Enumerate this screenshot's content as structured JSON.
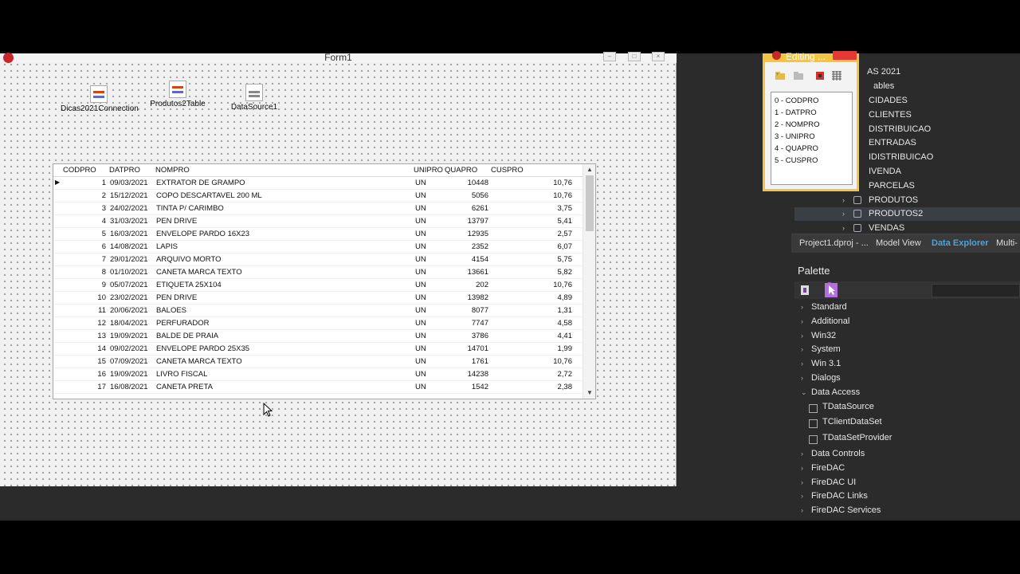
{
  "form": {
    "title": "Form1",
    "components": [
      {
        "name": "Dicas2021Connection"
      },
      {
        "name": "Produtos2Table"
      },
      {
        "name": "DataSource1"
      }
    ]
  },
  "grid": {
    "columns": [
      "CODPRO",
      "DATPRO",
      "NOMPRO",
      "UNIPRO",
      "QUAPRO",
      "CUSPRO"
    ],
    "rows": [
      [
        "1",
        "09/03/2021",
        "EXTRATOR DE GRAMPO",
        "UN",
        "10448",
        "10,76"
      ],
      [
        "2",
        "15/12/2021",
        "COPO DESCARTAVEL 200 ML",
        "UN",
        "5056",
        "10,76"
      ],
      [
        "3",
        "24/02/2021",
        "TINTA P/ CARIMBO",
        "UN",
        "6261",
        "3,75"
      ],
      [
        "4",
        "31/03/2021",
        "PEN DRIVE",
        "UN",
        "13797",
        "5,41"
      ],
      [
        "5",
        "16/03/2021",
        "ENVELOPE PARDO 16X23",
        "UN",
        "12935",
        "2,57"
      ],
      [
        "6",
        "14/08/2021",
        "LAPIS",
        "UN",
        "2352",
        "6,07"
      ],
      [
        "7",
        "29/01/2021",
        "ARQUIVO MORTO",
        "UN",
        "4154",
        "5,75"
      ],
      [
        "8",
        "01/10/2021",
        "CANETA MARCA TEXTO",
        "UN",
        "13661",
        "5,82"
      ],
      [
        "9",
        "05/07/2021",
        "ETIQUETA 25X104",
        "UN",
        "202",
        "10,76"
      ],
      [
        "10",
        "23/02/2021",
        "PEN DRIVE",
        "UN",
        "13982",
        "4,89"
      ],
      [
        "11",
        "20/06/2021",
        "BALOES",
        "UN",
        "8077",
        "1,31"
      ],
      [
        "12",
        "18/04/2021",
        "PERFURADOR",
        "UN",
        "7747",
        "4,58"
      ],
      [
        "13",
        "19/09/2021",
        "BALDE DE PRAIA",
        "UN",
        "3786",
        "4,41"
      ],
      [
        "14",
        "09/02/2021",
        "ENVELOPE PARDO 25X35",
        "UN",
        "14701",
        "1,99"
      ],
      [
        "15",
        "07/09/2021",
        "CANETA MARCA TEXTO",
        "UN",
        "1761",
        "10,76"
      ],
      [
        "16",
        "19/09/2021",
        "LIVRO FISCAL",
        "UN",
        "14238",
        "2,72"
      ],
      [
        "17",
        "16/08/2021",
        "CANETA PRETA",
        "UN",
        "1542",
        "2,38"
      ]
    ],
    "current_row_indicator": "▶"
  },
  "fields_editor": {
    "title": "Editing ...",
    "fields": [
      "0 - CODPRO",
      "1 - DATPRO",
      "2 - NOMPRO",
      "3 - UNIPRO",
      "4 - QUAPRO",
      "5 - CUSPRO"
    ]
  },
  "data_explorer": {
    "root_label": "AS 2021",
    "tables_label": "ables",
    "tables": [
      "CIDADES",
      "CLIENTES",
      "DISTRIBUICAO",
      "ENTRADAS",
      "IDISTRIBUICAO",
      "IVENDA",
      "PARCELAS",
      "PRODUTOS",
      "PRODUTOS2",
      "VENDAS"
    ],
    "selected": "PRODUTOS2"
  },
  "bottom_tabs": [
    "Project1.dproj - ...",
    "Model View",
    "Data Explorer",
    "Multi-"
  ],
  "active_tab": "Data Explorer",
  "palette": {
    "title": "Palette",
    "categories_before": [
      "Standard",
      "Additional",
      "Win32",
      "System",
      "Win 3.1",
      "Dialogs"
    ],
    "expanded_category": "Data Access",
    "expanded_items": [
      "TDataSource",
      "TClientDataSet",
      "TDataSetProvider"
    ],
    "categories_after": [
      "Data Controls",
      "FireDAC",
      "FireDAC UI",
      "FireDAC Links",
      "FireDAC Services"
    ]
  },
  "colors": {
    "accent_tab": "#4aa3df",
    "editor_border": "#f4c542",
    "ide_background": "#2b2b2b"
  }
}
